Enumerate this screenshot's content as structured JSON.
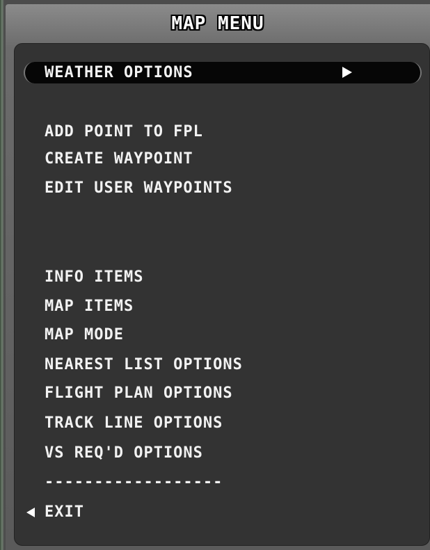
{
  "header": {
    "title": "MAP MENU"
  },
  "menu": {
    "selected": {
      "label": "WEATHER OPTIONS",
      "arrow_icon": "right-triangle-icon"
    },
    "items": [
      {
        "label": "ADD POINT TO FPL"
      },
      {
        "label": "CREATE WAYPOINT"
      },
      {
        "label": "EDIT USER WAYPOINTS"
      },
      {
        "label": "INFO ITEMS"
      },
      {
        "label": "MAP ITEMS"
      },
      {
        "label": "MAP MODE"
      },
      {
        "label": "NEAREST LIST OPTIONS"
      },
      {
        "label": "FLIGHT PLAN OPTIONS"
      },
      {
        "label": "TRACK LINE OPTIONS"
      },
      {
        "label": "VS REQ'D OPTIONS"
      }
    ],
    "separator": "------------------",
    "exit": {
      "label": "EXIT",
      "arrow_icon": "left-triangle-icon"
    }
  }
}
